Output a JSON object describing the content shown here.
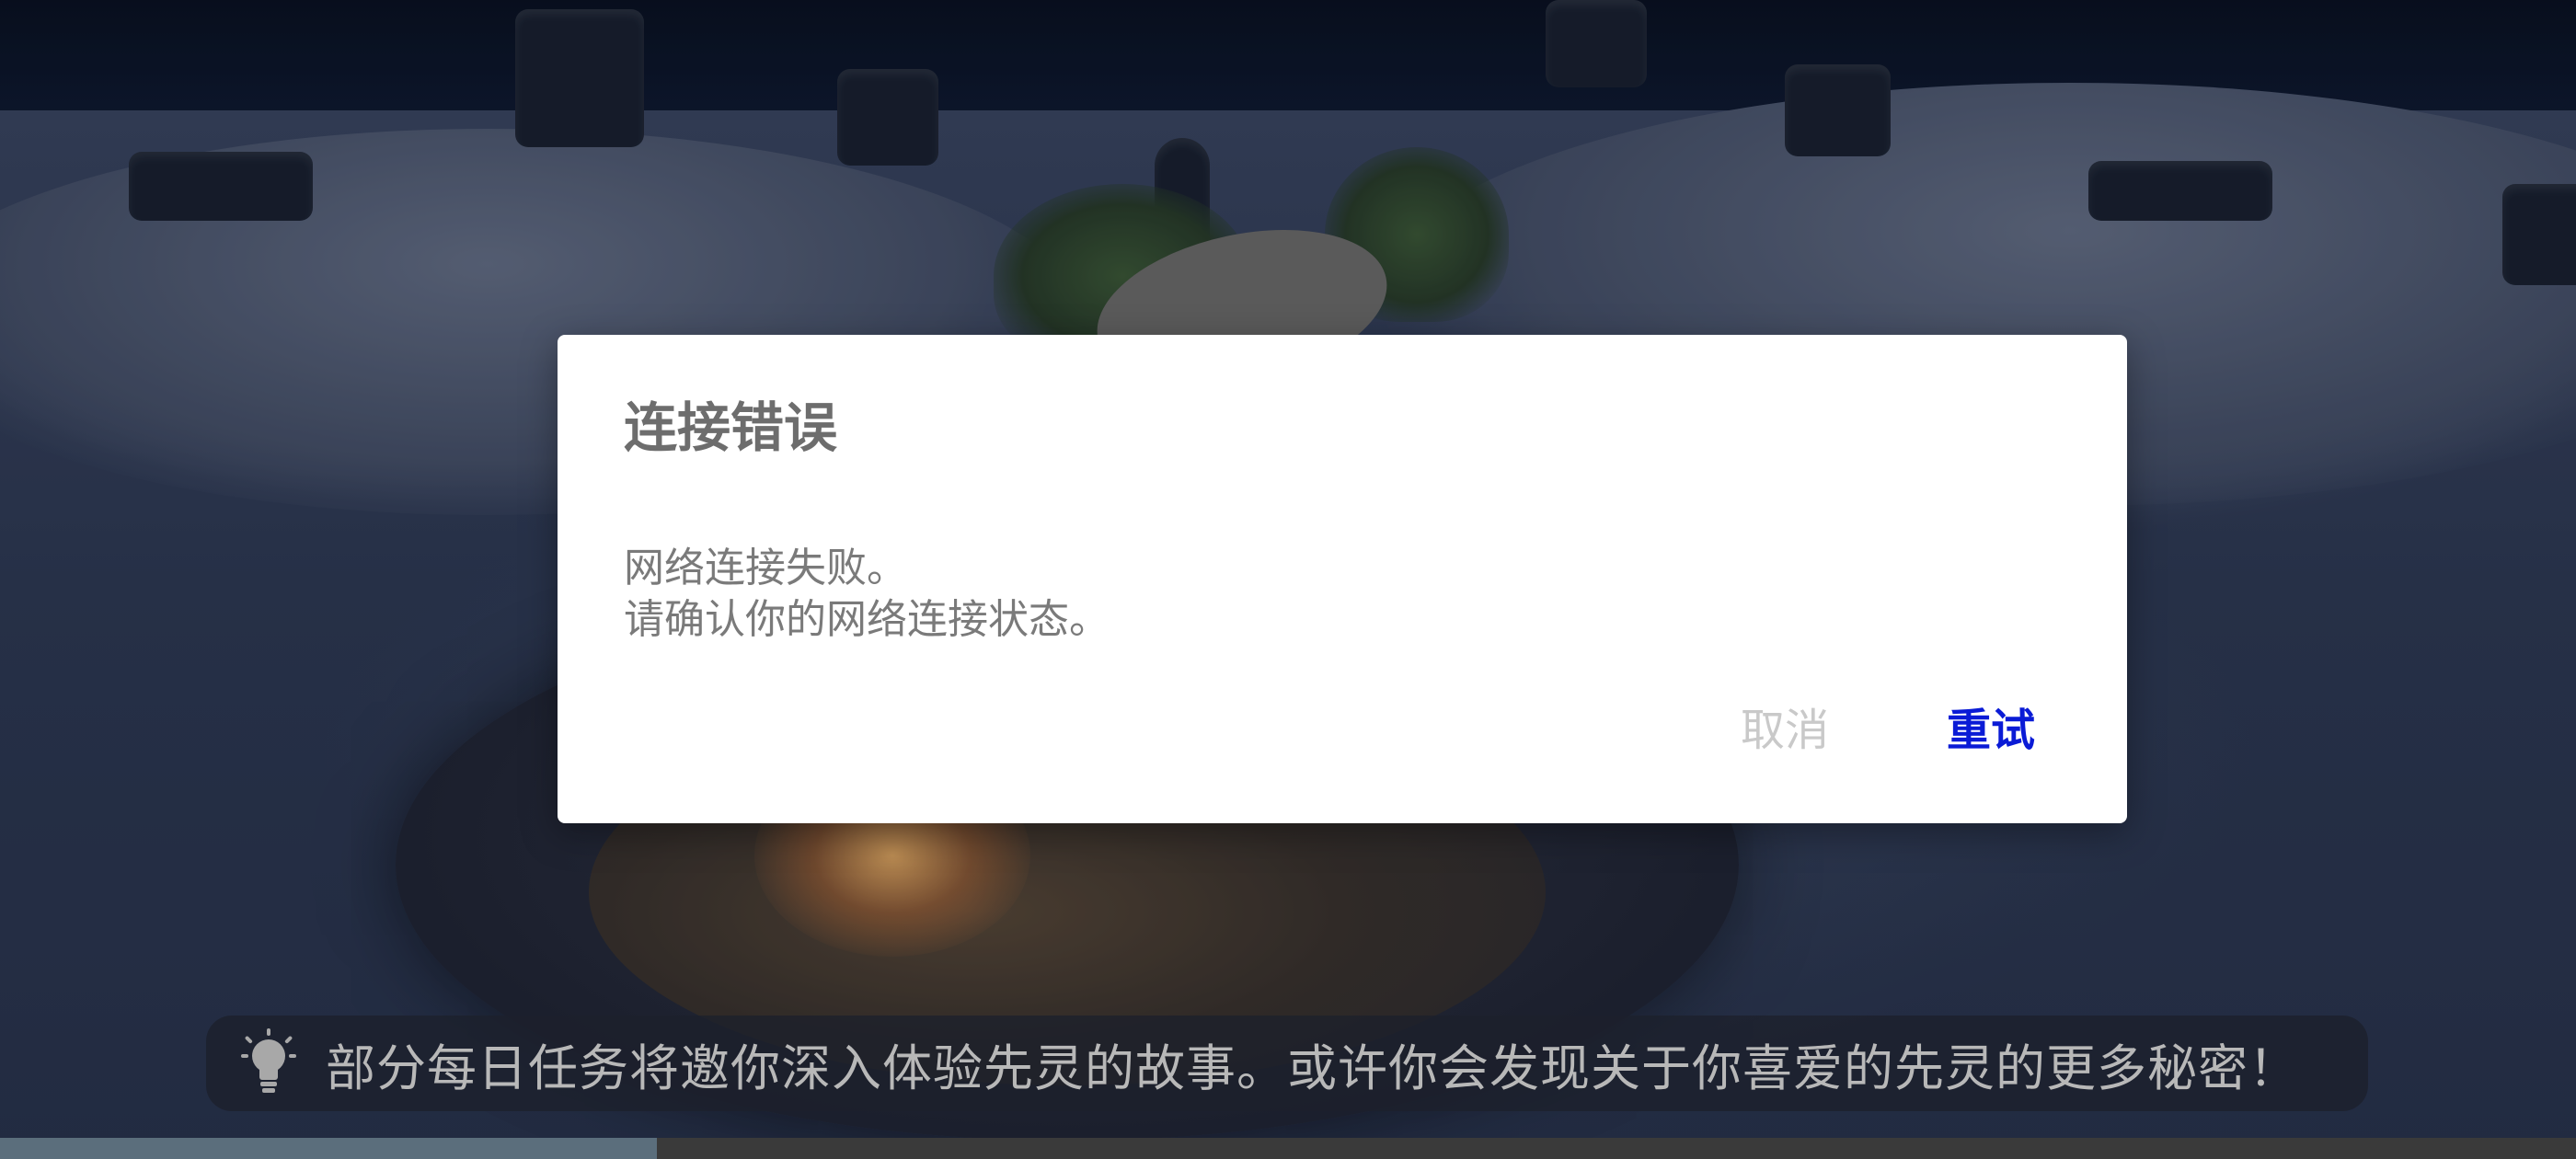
{
  "dialog": {
    "title": "连接错误",
    "message_lines": [
      "网络连接失败。",
      "请确认你的网络连接状态。"
    ],
    "cancel_label": "取消",
    "retry_label": "重试"
  },
  "tip": {
    "icon": "lightbulb-icon",
    "text": "部分每日任务将邀你深入体验先灵的故事。或许你会发现关于你喜爱的先灵的更多秘密！"
  },
  "loading": {
    "progress": 0.255
  },
  "colors": {
    "retry_accent": "#0a1bd6",
    "cancel_disabled": "#c9c9c9",
    "dialog_bg": "#ffffff"
  }
}
